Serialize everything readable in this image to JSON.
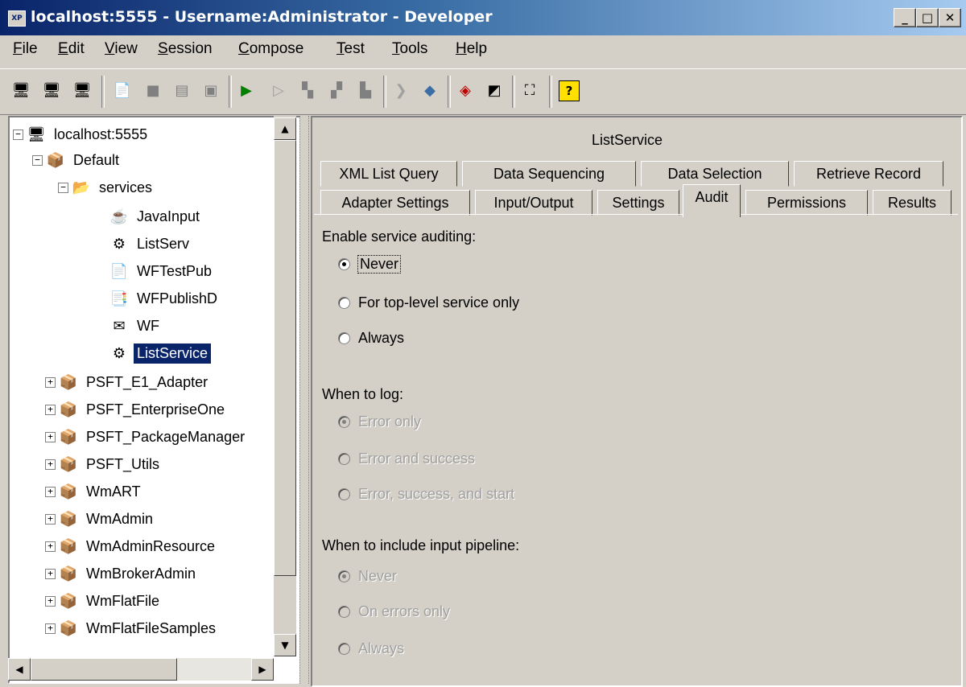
{
  "window": {
    "title": "localhost:5555 - Username:Administrator - Developer",
    "icon_text": "XP",
    "min_symbol": "_",
    "max_symbol": "□",
    "close_symbol": "✕"
  },
  "menu": [
    "File",
    "Edit",
    "View",
    "Session",
    "Compose",
    "Test",
    "Tools",
    "Help"
  ],
  "toolbar_icons": [
    "new-session-icon",
    "close-session-icon",
    "refresh-session-icon",
    "new-element-icon",
    "save-icon",
    "lock-icon",
    "unlock-icon",
    "run-icon",
    "step-icon",
    "step-into-icon",
    "step-over-icon",
    "trace-icon",
    "breakpoint-icon",
    "publish-icon",
    "view-icon",
    "edit-icon",
    "fit-icon",
    "help-icon"
  ],
  "tree": {
    "root": "localhost:5555",
    "items": [
      {
        "label": "Default",
        "type": "package",
        "expanded": true
      },
      {
        "label": "services",
        "type": "folder",
        "expanded": true
      },
      {
        "label": "JavaInput",
        "type": "java"
      },
      {
        "label": "ListServ",
        "type": "adapter"
      },
      {
        "label": "WFTestPub",
        "type": "document"
      },
      {
        "label": "WFPublishD",
        "type": "publish"
      },
      {
        "label": "WF",
        "type": "notification"
      },
      {
        "label": "ListService",
        "type": "adapter",
        "selected": true
      },
      {
        "label": "PSFT_E1_Adapter",
        "type": "package"
      },
      {
        "label": "PSFT_EnterpriseOne",
        "type": "package"
      },
      {
        "label": "PSFT_PackageManager",
        "type": "package"
      },
      {
        "label": "PSFT_Utils",
        "type": "package"
      },
      {
        "label": "WmART",
        "type": "package"
      },
      {
        "label": "WmAdmin",
        "type": "package"
      },
      {
        "label": "WmAdminResource",
        "type": "package"
      },
      {
        "label": "WmBrokerAdmin",
        "type": "package"
      },
      {
        "label": "WmFlatFile",
        "type": "package"
      },
      {
        "label": "WmFlatFileSamples",
        "type": "package"
      }
    ]
  },
  "panel": {
    "title": "ListService",
    "tabs_back": [
      "XML List Query",
      "Data Sequencing",
      "Data Selection",
      "Retrieve Record"
    ],
    "tabs_front": [
      "Adapter Settings",
      "Input/Output",
      "Settings",
      "Audit",
      "Permissions",
      "Results"
    ],
    "active_tab": "Audit"
  },
  "audit": {
    "enable_label": "Enable service auditing:",
    "enable_options": [
      "Never",
      "For top-level service only",
      "Always"
    ],
    "enable_selected": 0,
    "log_label": "When to log:",
    "log_options": [
      "Error only",
      "Error and success",
      "Error, success, and start"
    ],
    "log_selected": 0,
    "pipeline_label": "When to include input pipeline:",
    "pipeline_options": [
      "Never",
      "On errors only",
      "Always"
    ],
    "pipeline_selected": 0
  },
  "colors": {
    "title_bg": "#0a246a",
    "selection_bg": "#0a246a",
    "chrome": "#d4d0c8",
    "disabled_text": "#a0a0a0"
  }
}
